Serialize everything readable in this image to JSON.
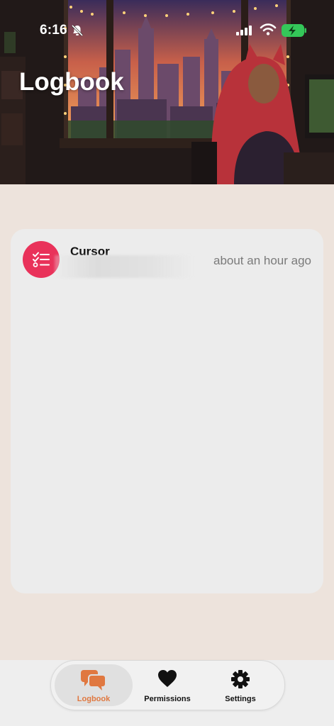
{
  "status_bar": {
    "time": "6:16"
  },
  "header": {
    "title": "Logbook"
  },
  "logbook": {
    "entries": [
      {
        "app": "Cursor",
        "time_ago": "about an hour ago"
      }
    ]
  },
  "tabbar": {
    "tabs": [
      {
        "label": "Logbook",
        "icon": "chat-bubbles-icon",
        "active": true
      },
      {
        "label": "Permissions",
        "icon": "heart-icon",
        "active": false
      },
      {
        "label": "Settings",
        "icon": "gear-icon",
        "active": false
      }
    ]
  },
  "colors": {
    "accent": "#e07840",
    "avatar": "#e9325a",
    "battery": "#34c759"
  }
}
